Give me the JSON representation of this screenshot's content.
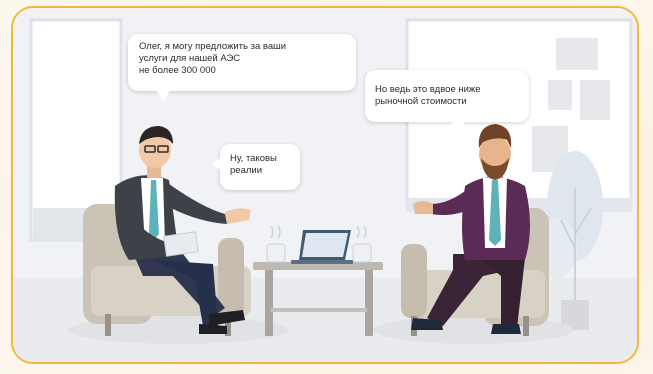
{
  "scene": {
    "bubble_left_top": "Олег, я могу предложить за ваши\nуслуги для нашей АЭС\nне более 300 000",
    "bubble_left_reply": "Ну, таковы\nреалии",
    "bubble_right": "Но ведь это вдвое ниже\nрыночной стоимости"
  },
  "colors": {
    "frame_border": "#f2b63a",
    "wall": "#eceff3",
    "window": "#ffffff",
    "chair": "#cfc6b8",
    "suit_left": "#3e4147",
    "suit_right": "#5b2b55",
    "pants_left": "#2e3650",
    "pants_right": "#3b2436",
    "tie": "#5fb3b8",
    "table": "#b9b4ad",
    "laptop": "#3e5b74"
  }
}
